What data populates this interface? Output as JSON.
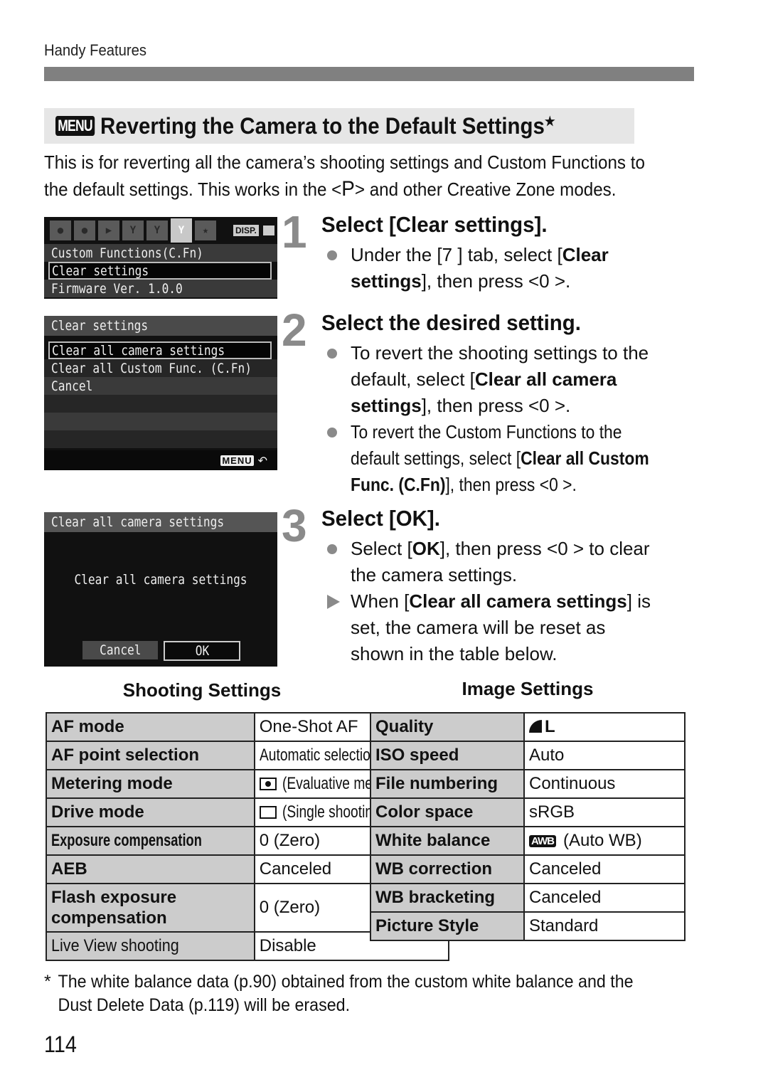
{
  "header": {
    "section_label": "Handy Features"
  },
  "title": {
    "icon": "MENU",
    "text": "Reverting the Camera to the Default Settings",
    "star": "★"
  },
  "intro": {
    "line1": "This is for reverting all the camera’s shooting settings and Custom Functions to",
    "line2_a": "the default settings. This works in the <",
    "line2_p": "P",
    "line2_b": "> and other Creative Zone modes."
  },
  "screens": {
    "screen1": {
      "tabs": [
        "shooting-1",
        "shooting-2",
        "playback",
        "setup-1",
        "setup-2",
        "setup-3",
        "my-menu"
      ],
      "active_tab_index": 5,
      "disp_label": "DISP.",
      "items": [
        "Custom Functions(C.Fn)",
        "Clear settings",
        "Firmware Ver. 1.0.0"
      ],
      "selected_index": 1
    },
    "screen2": {
      "title": "Clear settings",
      "items": [
        "Clear all camera settings",
        "Clear all Custom Func. (C.Fn)",
        "Cancel"
      ],
      "selected_index": 0,
      "footer_menu": "MENU",
      "footer_return": "↶"
    },
    "screen3": {
      "title": "Clear all camera settings",
      "message": "Clear all camera settings",
      "cancel_label": "Cancel",
      "ok_label": "OK",
      "selected_button": "OK"
    }
  },
  "steps": [
    {
      "number": "1",
      "title": "Select [Clear settings].",
      "bullets": [
        {
          "type": "dot",
          "l1_a": "Under the [7   ] tab, select [",
          "l1_b": "Clear",
          "l2_a": "settings",
          "l2_b": "], then press <0   >."
        }
      ]
    },
    {
      "number": "2",
      "title": "Select the desired setting.",
      "bullets": [
        {
          "type": "dot",
          "l1": "To revert the shooting settings to the",
          "l2_a": "default, select [",
          "l2_b": "Clear all camera",
          "l3_a": "settings",
          "l3_b": "], then press <0   >."
        },
        {
          "type": "dot",
          "l1": "To revert the Custom Functions to the",
          "l2_a": "default settings, select [",
          "l2_b": "Clear all Custom",
          "l3_a": "Func. (C.Fn)",
          "l3_b": "], then press <0   >."
        }
      ]
    },
    {
      "number": "3",
      "title": "Select [OK].",
      "bullets": [
        {
          "type": "dot",
          "l1_a": "Select [",
          "l1_b": "OK",
          "l1_c": "], then press <0   > to clear",
          "l2": "the camera settings."
        },
        {
          "type": "arrow",
          "l1_a": "When [",
          "l1_b": "Clear all camera settings",
          "l1_c": "] is",
          "l2": "set, the camera will be reset as",
          "l3": "shown in the table below."
        }
      ]
    }
  ],
  "shooting_settings": {
    "title": "Shooting Settings",
    "rows": [
      {
        "key": "AF mode",
        "value": "One-Shot AF"
      },
      {
        "key": "AF point selection",
        "value": "Automatic selection"
      },
      {
        "key": "Metering mode",
        "icon": "evaluative-metering-icon",
        "value": "(Evaluative metering)"
      },
      {
        "key": "Drive mode",
        "icon": "single-shooting-icon",
        "value": "(Single shooting)"
      },
      {
        "key": "Exposure compensation",
        "value": "0 (Zero)"
      },
      {
        "key": "AEB",
        "value": "Canceled"
      },
      {
        "key": "Flash exposure compensation",
        "value": "0 (Zero)"
      },
      {
        "key": "Live View shooting",
        "value": "Disable"
      }
    ]
  },
  "image_settings": {
    "title": "Image Settings",
    "rows": [
      {
        "key": "Quality",
        "icon": "fine-quality-icon",
        "value": "L"
      },
      {
        "key": "ISO speed",
        "value": "Auto"
      },
      {
        "key": "File numbering",
        "value": "Continuous"
      },
      {
        "key": "Color space",
        "value": "sRGB"
      },
      {
        "key": "White balance",
        "icon": "AWB",
        "value": "(Auto WB)"
      },
      {
        "key": "WB correction",
        "value": "Canceled"
      },
      {
        "key": "WB bracketing",
        "value": "Canceled"
      },
      {
        "key": "Picture Style",
        "value": "Standard"
      }
    ]
  },
  "footnote": {
    "asterisk": "*",
    "line1": "The white balance data (p.90) obtained from the custom white balance and the",
    "line2": "Dust Delete Data (p.119) will be erased."
  },
  "page_number": "114"
}
